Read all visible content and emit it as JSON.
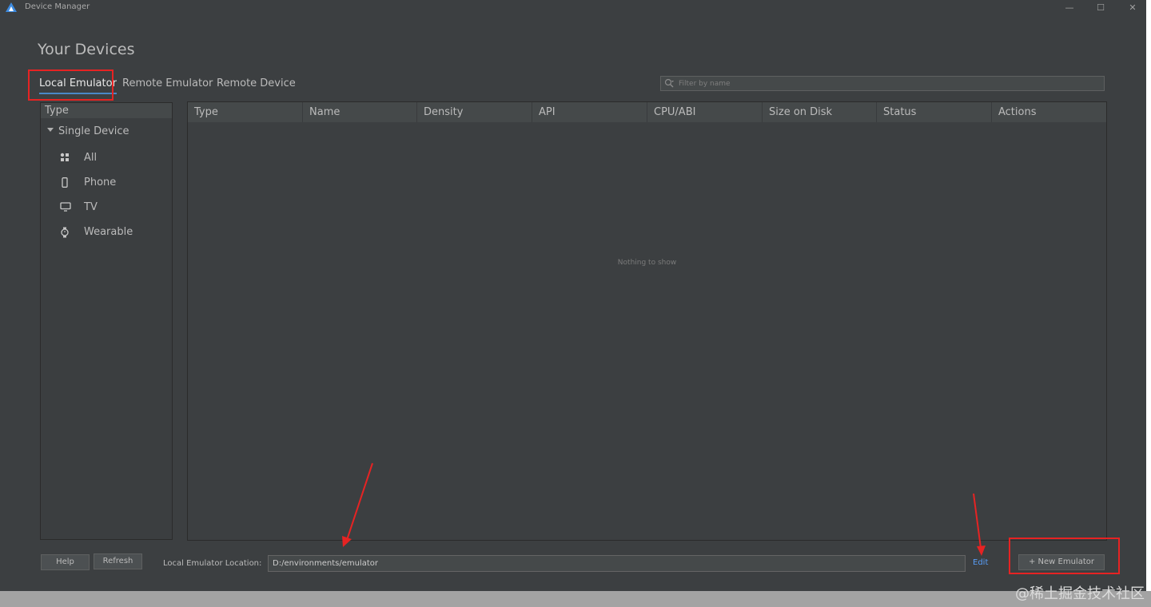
{
  "window": {
    "title": "Device Manager",
    "minimize_glyph": "—",
    "maximize_glyph": "☐",
    "close_glyph": "✕"
  },
  "page": {
    "title": "Your Devices"
  },
  "tabs": [
    {
      "label": "Local Emulator",
      "active": true
    },
    {
      "label": "Remote Emulator",
      "active": false
    },
    {
      "label": "Remote Device",
      "active": false
    }
  ],
  "filter": {
    "placeholder": "Filter by name",
    "value": ""
  },
  "sidebar": {
    "header": "Type",
    "group": "Single Device",
    "items": [
      {
        "label": "All",
        "icon": "grid-icon"
      },
      {
        "label": "Phone",
        "icon": "phone-icon"
      },
      {
        "label": "TV",
        "icon": "tv-icon"
      },
      {
        "label": "Wearable",
        "icon": "watch-icon"
      }
    ]
  },
  "table": {
    "columns": [
      "Type",
      "Name",
      "Density",
      "API",
      "CPU/ABI",
      "Size on Disk",
      "Status",
      "Actions"
    ],
    "rows": [],
    "empty_text": "Nothing to show"
  },
  "footer": {
    "help_label": "Help",
    "refresh_label": "Refresh",
    "location_label": "Local Emulator Location:",
    "location_value": "D:/environments/emulator",
    "edit_label": "Edit",
    "new_emulator_label": "+ New Emulator"
  },
  "watermark": "@稀土掘金技术社区",
  "colors": {
    "background": "#3c3f41",
    "header": "#45494a",
    "accent": "#4a88c7",
    "link": "#589df6",
    "annotation": "#e62323"
  }
}
